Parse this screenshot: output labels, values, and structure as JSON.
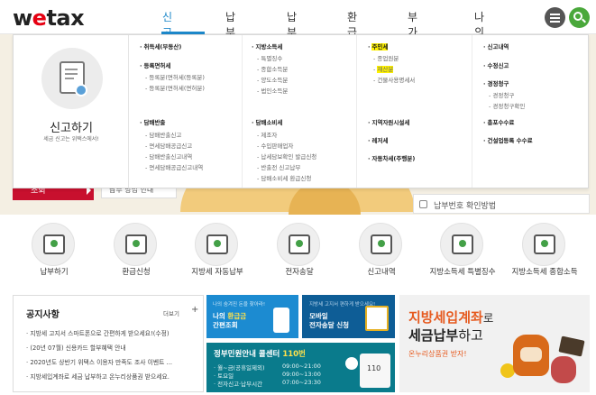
{
  "header": {
    "logo_w": "w",
    "logo_e": "e",
    "logo_rest": "tax",
    "nav": [
      "신고하기",
      "납부하기",
      "납부결과",
      "환급신청",
      "부가서비스",
      "나의 위택스"
    ]
  },
  "hero": {
    "red_button": "조회",
    "white_button": "납부 방법 안내",
    "tip": "납부번호 확인방법"
  },
  "mega": {
    "title": "신고하기",
    "subtitle": "세금 신고는 위택스에서!",
    "col1": {
      "h1": "취득세(부동산)",
      "h2": "등록면허세",
      "s2a": "등록분(면허세(등록분)",
      "s2b": "등록분(면허세(면허분)",
      "h3": "담배반출",
      "s3a": "담배반출신고",
      "s3b": "면세담배공급신고",
      "s3c": "담배반출신고내역",
      "s3d": "면세담배공급신고내역"
    },
    "col2": {
      "h1": "지방소득세",
      "s1a": "특별징수",
      "s1b": "종합소득분",
      "s1c": "양도소득분",
      "s1d": "법인소득분",
      "h2": "담배소비세",
      "s2a": "제조자",
      "s2b": "수입판매업자",
      "s2c": "납세담보확인 발급신청",
      "s2d": "반출전 신고납부",
      "s2e": "담배소비세 환급신청"
    },
    "col3": {
      "h1": "주민세",
      "s1a": "종업원분",
      "s1b": "재산분",
      "s1c": "건물사용명세서",
      "h2": "지역자원시설세",
      "h3": "레저세",
      "h4": "자동차세(주행분)"
    },
    "col4": {
      "h1": "신고내역",
      "h2": "수정신고",
      "h3": "경정청구",
      "s3a": "경정청구",
      "s3b": "경정청구확인",
      "h4": "총포수수료",
      "h5": "건설업등록 수수료"
    }
  },
  "services": [
    {
      "label": "납부하기",
      "icon": "payment-icon"
    },
    {
      "label": "환급신청",
      "icon": "refund-icon"
    },
    {
      "label": "지방세 자동납부",
      "icon": "auto-pay-icon"
    },
    {
      "label": "전자송달",
      "icon": "e-delivery-icon"
    },
    {
      "label": "신고내역",
      "icon": "report-history-icon"
    },
    {
      "label": "지방소득세 특별징수",
      "icon": "income-tax-special-icon"
    },
    {
      "label": "지방소득세 종합소득",
      "icon": "income-tax-general-icon"
    }
  ],
  "notice": {
    "title": "공지사항",
    "more": "더보기",
    "items": [
      "지방세 고지서 스마트폰으로 간편하게 받으세요!(수정)",
      "(20년 07월) 신용카드 할부혜택 안내",
      "2020년도 상반기 위택스 이용자 만족도 조사 이벤트 ...",
      "지방세입계좌로 세금 납부하고 온누리상품권 받으세요."
    ]
  },
  "banner1": {
    "small": "나의 숨겨진 돈을 찾아라!",
    "line1_a": "나의 ",
    "line1_b": "환급금",
    "line2": "간편조회"
  },
  "banner2": {
    "small": "지방세 고지서 편하게 받으세요!",
    "line1": "모바일",
    "line2": "전자송달 신청"
  },
  "banner3": {
    "title_a": "정부민원안내 콜센터 ",
    "title_b": "110번",
    "rows": [
      {
        "k": "월~금(공휴일제외)",
        "v": "09:00~21:00"
      },
      {
        "k": "토요일",
        "v": "09:00~13:00"
      },
      {
        "k": "전자신고·납부시간",
        "v": "07:00~23:30"
      }
    ],
    "box": "110"
  },
  "banner4": {
    "line1": "지방세입계좌",
    "line1_suffix": "로",
    "line2_a": "세금납부",
    "line2_b": "하고",
    "line3": "온누리상품권 받자!"
  },
  "colors": {
    "accent": "#1c87c9",
    "brand_red": "#e60012",
    "green": "#4aa83b",
    "highlight": "#fff200"
  }
}
